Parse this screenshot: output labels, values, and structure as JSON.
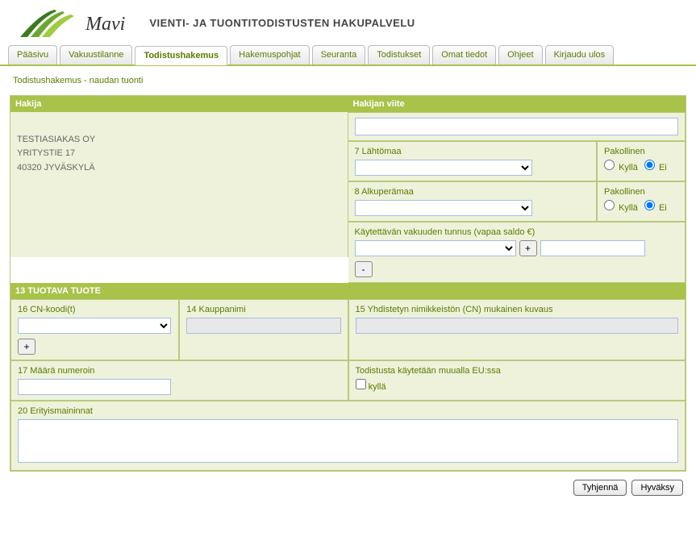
{
  "header": {
    "brand": "Mavi",
    "site_title": "VIENTI- JA TUONTITODISTUSTEN HAKUPALVELU"
  },
  "tabs": {
    "items": [
      {
        "label": "Pääsivu"
      },
      {
        "label": "Vakuustilanne"
      },
      {
        "label": "Todistushakemus"
      },
      {
        "label": "Hakemuspohjat"
      },
      {
        "label": "Seuranta"
      },
      {
        "label": "Todistukset"
      },
      {
        "label": "Omat tiedot"
      },
      {
        "label": "Ohjeet"
      },
      {
        "label": "Kirjaudu ulos"
      }
    ],
    "active_index": 2
  },
  "breadcrumb": "Todistushakemus - naudan tuonti",
  "sections": {
    "hakija": {
      "title": "Hakija",
      "name": "TESTIASIAKAS OY",
      "street": "YRITYSTIE 17",
      "postal": "40320  JYVÄSKYLÄ"
    },
    "hakijan_viite": {
      "title": "Hakijan viite",
      "value": ""
    },
    "lahtomaa": {
      "label": "7 Lähtömaa",
      "pakollinen_label": "Pakollinen",
      "kylla": "Kyllä",
      "ei": "Ei",
      "selected": "ei"
    },
    "alkuperamaa": {
      "label": "8 Alkuperämaa",
      "pakollinen_label": "Pakollinen",
      "kylla": "Kyllä",
      "ei": "Ei",
      "selected": "ei"
    },
    "vakuus": {
      "label": "Käytettävän vakuuden tunnus (vapaa saldo €)",
      "plus": "+",
      "minus": "-"
    },
    "tuotava_tuote": {
      "title": "13 TUOTAVA TUOTE"
    },
    "cn_koodi": {
      "label": "16 CN-koodi(t)",
      "plus": "+"
    },
    "kauppanimi": {
      "label": "14 Kauppanimi"
    },
    "kuvaus": {
      "label": "15 Yhdistetyn nimikkeistön (CN) mukainen kuvaus"
    },
    "maara": {
      "label": "17 Määrä numeroin"
    },
    "eu_use": {
      "label": "Todistusta käytetään muualla EU:ssa",
      "checkbox": "kyllä"
    },
    "erityis": {
      "label": "20 Erityismaininnat"
    }
  },
  "buttons": {
    "tyhjenna": "Tyhjennä",
    "hyvaksy": "Hyväksy"
  }
}
